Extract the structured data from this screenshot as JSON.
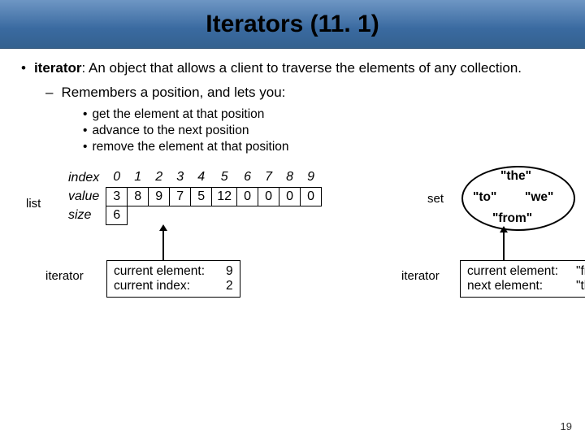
{
  "header": {
    "title": "Iterators (11. 1)"
  },
  "def": {
    "term": "iterator",
    "text": ": An object that allows a client to traverse the elements of any collection."
  },
  "sub1": "Remembers a position, and lets you:",
  "caps": {
    "a": "get the element at that position",
    "b": "advance to the next position",
    "c": "remove the element at that position"
  },
  "list": {
    "label": "list",
    "indexLabel": "index",
    "valueLabel": "value",
    "sizeLabel": "size",
    "indexes": [
      "0",
      "1",
      "2",
      "3",
      "4",
      "5",
      "6",
      "7",
      "8",
      "9"
    ],
    "values": [
      "3",
      "8",
      "9",
      "7",
      "5",
      "12",
      "0",
      "0",
      "0",
      "0"
    ],
    "size": "6"
  },
  "listIter": {
    "label": "iterator",
    "k1": "current element:",
    "v1": "9",
    "k2": "current index:",
    "v2": "2"
  },
  "set": {
    "label": "set",
    "items": {
      "the": "\"the\"",
      "to": "\"to\"",
      "we": "\"we\"",
      "from": "\"from\""
    }
  },
  "setIter": {
    "label": "iterator",
    "k1": "current element:",
    "v1": "\"from\"",
    "k2": "next element:",
    "v2": "\"the\""
  },
  "page": "19"
}
